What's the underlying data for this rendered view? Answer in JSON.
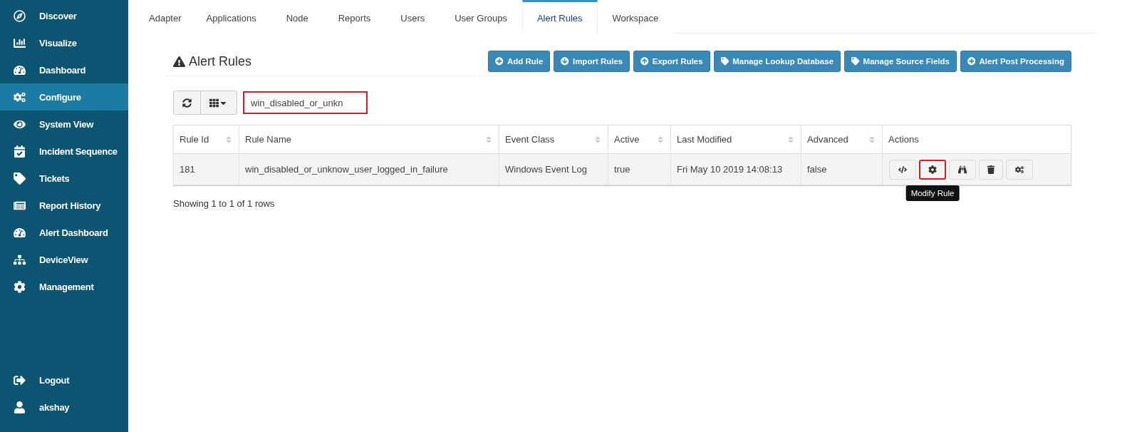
{
  "sidebar": {
    "items": [
      {
        "label": "Discover",
        "selected": false
      },
      {
        "label": "Visualize",
        "selected": false
      },
      {
        "label": "Dashboard",
        "selected": false
      },
      {
        "label": "Configure",
        "selected": true
      },
      {
        "label": "System View",
        "selected": false
      },
      {
        "label": "Incident Sequence",
        "selected": false
      },
      {
        "label": "Tickets",
        "selected": false
      },
      {
        "label": "Report History",
        "selected": false
      },
      {
        "label": "Alert Dashboard",
        "selected": false
      },
      {
        "label": "DeviceView",
        "selected": false
      },
      {
        "label": "Management",
        "selected": false
      }
    ],
    "bottom_items": [
      {
        "label": "Logout"
      },
      {
        "label": "akshay"
      }
    ]
  },
  "tabs": [
    {
      "label": "Adapter",
      "selected": false
    },
    {
      "label": "Applications",
      "selected": false
    },
    {
      "label": "Node",
      "selected": false
    },
    {
      "label": "Reports",
      "selected": false
    },
    {
      "label": "Users",
      "selected": false
    },
    {
      "label": "User Groups",
      "selected": false
    },
    {
      "label": "Alert Rules",
      "selected": true
    },
    {
      "label": "Workspace",
      "selected": false
    }
  ],
  "page_title": "Alert Rules",
  "buttons": [
    "Add Rule",
    "Import Rules",
    "Export Rules",
    "Manage Lookup Database",
    "Manage Source Fields",
    "Alert Post Processing"
  ],
  "search": {
    "value": "win_disabled_or_unkn",
    "highlighted": true
  },
  "table": {
    "columns": [
      {
        "label": "Rule Id",
        "sortable": true
      },
      {
        "label": "Rule Name",
        "sortable": true
      },
      {
        "label": "Event Class",
        "sortable": true
      },
      {
        "label": "Active",
        "sortable": true
      },
      {
        "label": "Last Modified",
        "sortable": true
      },
      {
        "label": "Advanced",
        "sortable": true
      },
      {
        "label": "Actions",
        "sortable": false
      }
    ],
    "rows": [
      {
        "cells": [
          "181",
          "win_disabled_or_unknow_user_logged_in_failure",
          "Windows Event Log",
          "true",
          "Fri May 10 2019 14:08:13",
          "false"
        ],
        "actions": [
          {
            "highlighted": false
          },
          {
            "highlighted": true,
            "tooltip": "Modify Rule"
          },
          {
            "highlighted": false
          },
          {
            "highlighted": false
          },
          {
            "highlighted": false
          }
        ]
      }
    ]
  },
  "pagination_info": "Showing 1 to 1 of 1 rows"
}
